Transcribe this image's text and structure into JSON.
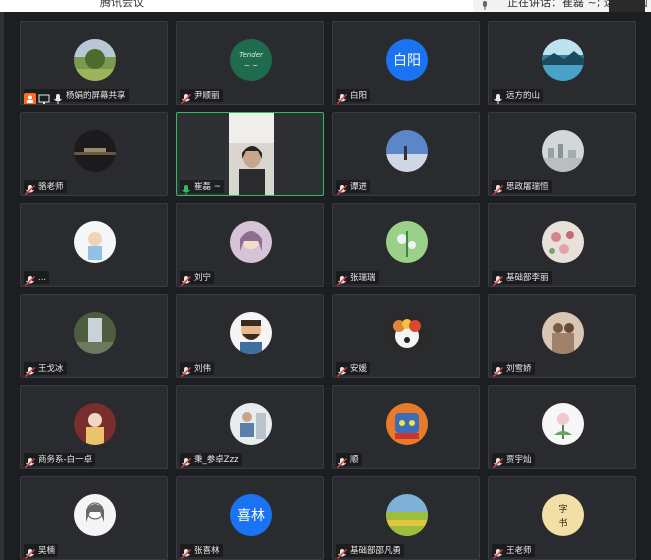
{
  "window": {
    "app_title": "腾讯会议",
    "speaking_text": "正在讲话：崔磊 ~; 远方的山"
  },
  "participants": [
    {
      "name": "杨娟的屏幕共享",
      "avatar": "photo-landscape",
      "muted": false,
      "sharing": true
    },
    {
      "name": "尹顺丽",
      "avatar": "photo-green-handwriting",
      "muted": true
    },
    {
      "name": "白阳",
      "avatar_text": "白阳",
      "muted": true
    },
    {
      "name": "远方的山",
      "avatar": "photo-lake",
      "muted": false
    },
    {
      "name": "骆老师",
      "avatar": "photo-dark-boat",
      "muted": true
    },
    {
      "name": "崔磊 ~",
      "video": "camera-person",
      "muted": false,
      "active_speaker": true
    },
    {
      "name": "谭进",
      "avatar": "photo-sky",
      "muted": true
    },
    {
      "name": "思政屠瑞恒",
      "avatar": "photo-city",
      "muted": true
    },
    {
      "name": "...",
      "avatar": "photo-cartoon-boy",
      "muted": true
    },
    {
      "name": "刘宁",
      "avatar": "photo-anime-girl",
      "muted": true
    },
    {
      "name": "张瑞瑞",
      "avatar": "photo-green-plant",
      "muted": true
    },
    {
      "name": "基础部李丽",
      "avatar": "photo-flowers",
      "muted": true
    },
    {
      "name": "王戈冰",
      "avatar": "photo-waterfall",
      "muted": true
    },
    {
      "name": "刘伟",
      "avatar": "photo-bearded-cartoon",
      "muted": true
    },
    {
      "name": "安媛",
      "avatar": "photo-dog",
      "muted": true
    },
    {
      "name": "刘雪娇",
      "avatar": "photo-couple",
      "muted": true
    },
    {
      "name": "商务系-白一卓",
      "avatar": "photo-girl-costume",
      "muted": true
    },
    {
      "name": "秉_参卓Zzz",
      "avatar": "photo-reader",
      "muted": true
    },
    {
      "name": "顺",
      "avatar": "photo-robot",
      "muted": true
    },
    {
      "name": "贾宇灿",
      "avatar": "photo-white-flower",
      "muted": true
    },
    {
      "name": "吴楠",
      "avatar": "photo-sketch-girl",
      "muted": true
    },
    {
      "name": "张喜林",
      "avatar_text": "喜林",
      "muted": true
    },
    {
      "name": "基础部邵凡勇",
      "avatar": "photo-field",
      "muted": true
    },
    {
      "name": "王老师",
      "avatar": "photo-calligraphy",
      "muted": true
    }
  ],
  "colors": {
    "tile_bg": "#2a2b2e",
    "active_border": "#2dbd63",
    "text_avatar_bg": "#1a73f0",
    "muted_icon": "#e03d3d",
    "share_badge": "#ff6a1f"
  }
}
